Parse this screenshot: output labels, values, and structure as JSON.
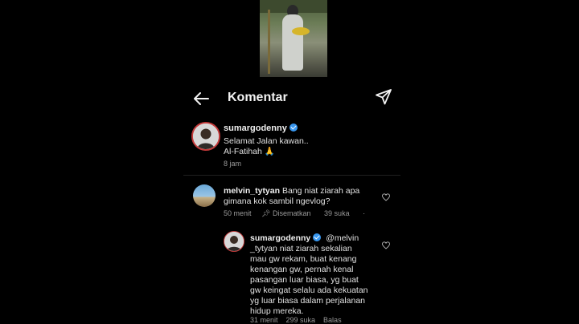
{
  "thumbnail": {
    "icon": "video-thumbnail"
  },
  "header": {
    "title": "Komentar",
    "back_icon": "arrow-left-icon",
    "share_icon": "paper-plane-icon"
  },
  "caption": {
    "username": "sumargodenny",
    "verified": true,
    "line1": "Selamat Jalan kawan..",
    "line2": "Al-Fatihah 🙏",
    "time": "8 jam"
  },
  "comments": [
    {
      "username": "melvin_tytyan",
      "line1": "Bang niat ziarah apa",
      "line2": "gimana kok sambil ngevlog?",
      "time": "50 menit",
      "pinned_label": "Disematkan",
      "likes": "39 suka",
      "more": "·"
    }
  ],
  "reply": {
    "username": "sumargodenny",
    "verified": true,
    "mention": "@melvin",
    "lines": [
      "_tytyan niat ziarah sekalian",
      "mau gw rekam, buat kenang",
      "kenangan gw, pernah kenal",
      "pasangan luar biasa, yg buat",
      "gw keingat selalu ada kekuatan",
      "yg luar biasa dalam perjalanan",
      "hidup mereka."
    ],
    "footer_partial": "31 menit    299 suka    Balas"
  },
  "colors": {
    "background": "#000000",
    "verified": "#3897f0",
    "story_ring": "#c43a3a"
  }
}
